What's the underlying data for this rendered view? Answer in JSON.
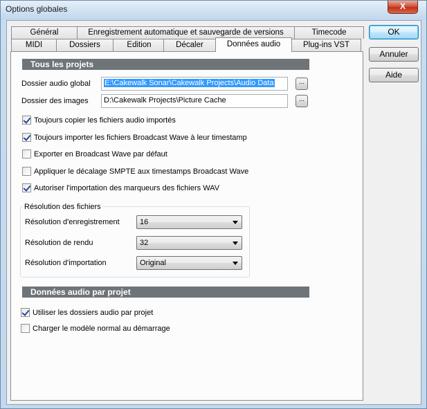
{
  "window": {
    "title": "Options globales",
    "close_label": "X"
  },
  "tabs": {
    "row_top": [
      {
        "label": "Général"
      },
      {
        "label": "Enregistrement automatique et sauvegarde de versions"
      },
      {
        "label": "Timecode"
      }
    ],
    "row_bottom": [
      {
        "label": "MIDI"
      },
      {
        "label": "Dossiers"
      },
      {
        "label": "Edition"
      },
      {
        "label": "Décaler"
      },
      {
        "label": "Données audio",
        "active": true
      },
      {
        "label": "Plug-ins VST"
      }
    ]
  },
  "section_all": {
    "header": "Tous les projets",
    "global_audio_label": "Dossier audio global",
    "global_audio_value": "E:\\Cakewalk Sonar\\Cakewalk Projects\\Audio Data",
    "images_label": "Dossier des images",
    "images_value": "D:\\Cakewalk Projects\\Picture Cache",
    "browse_label": "...",
    "checkboxes": [
      {
        "label": "Toujours copier les fichiers audio importés",
        "checked": true
      },
      {
        "label": "Toujours importer les fichiers Broadcast Wave à leur timestamp",
        "checked": true
      },
      {
        "label": "Exporter en Broadcast Wave par défaut",
        "checked": false
      },
      {
        "label": "Appliquer le décalage SMPTE aux timestamps Broadcast Wave",
        "checked": false
      },
      {
        "label": "Autoriser l'importation des marqueurs des fichiers WAV",
        "checked": true
      }
    ]
  },
  "resolution": {
    "title": "Résolution des fichiers",
    "record_label": "Résolution d'enregistrement",
    "record_value": "16",
    "render_label": "Résolution de rendu",
    "render_value": "32",
    "import_label": "Résolution d'importation",
    "import_value": "Original"
  },
  "section_per_project": {
    "header": "Données audio par projet",
    "checkboxes": [
      {
        "label": "Utiliser les dossiers audio par projet",
        "checked": true
      },
      {
        "label": "Charger le modèle normal au démarrage",
        "checked": false
      }
    ]
  },
  "buttons": {
    "ok": "OK",
    "cancel": "Annuler",
    "help": "Aide"
  }
}
